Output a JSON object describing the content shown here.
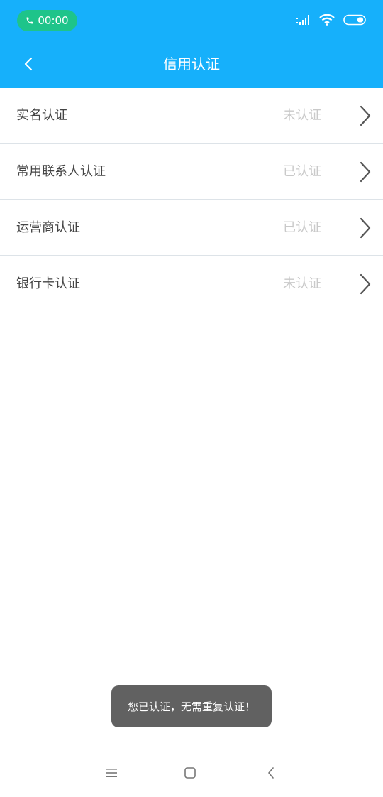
{
  "status_bar": {
    "call_time": "00:00",
    "icons": [
      "phone-icon",
      "signal-icon",
      "wifi-icon",
      "battery-icon"
    ]
  },
  "header": {
    "title": "信用认证",
    "back_icon": "chevron-left-icon"
  },
  "items": [
    {
      "label": "实名认证",
      "status": "未认证"
    },
    {
      "label": "常用联系人认证",
      "status": "已认证"
    },
    {
      "label": "运营商认证",
      "status": "已认证"
    },
    {
      "label": "银行卡认证",
      "status": "未认证"
    }
  ],
  "toast": {
    "message": "您已认证，无需重复认证！"
  },
  "nav": {
    "icons": [
      "menu-icon",
      "home-icon",
      "back-icon"
    ]
  },
  "colors": {
    "header_bg": "#16b0fb",
    "call_pill": "#1ec48a",
    "status_text": "#c9c9c9",
    "toast_bg": "#616161"
  }
}
